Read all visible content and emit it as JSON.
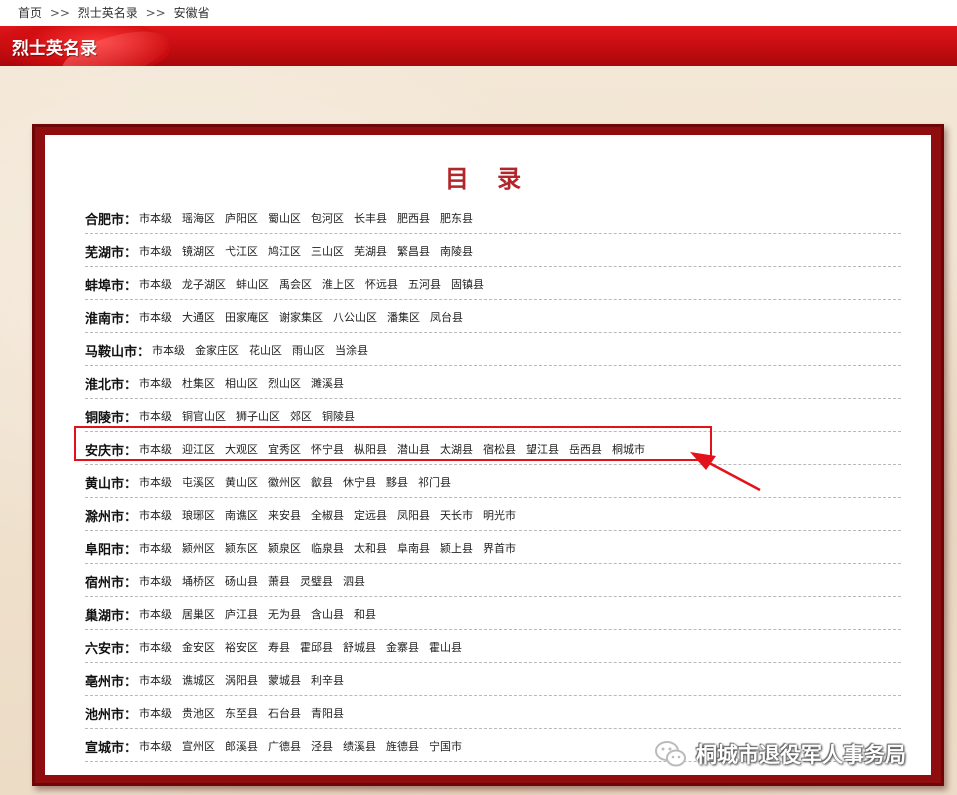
{
  "breadcrumb": [
    "首页",
    "烈士英名录",
    "安徽省"
  ],
  "breadcrumb_sep": ">>",
  "header": {
    "title": "烈士英名录"
  },
  "toc": {
    "title": "目 录",
    "rows": [
      {
        "city": "合肥市",
        "items": [
          "市本级",
          "瑶海区",
          "庐阳区",
          "蜀山区",
          "包河区",
          "长丰县",
          "肥西县",
          "肥东县"
        ]
      },
      {
        "city": "芜湖市",
        "items": [
          "市本级",
          "镜湖区",
          "弋江区",
          "鸠江区",
          "三山区",
          "芜湖县",
          "繁昌县",
          "南陵县"
        ]
      },
      {
        "city": "蚌埠市",
        "items": [
          "市本级",
          "龙子湖区",
          "蚌山区",
          "禹会区",
          "淮上区",
          "怀远县",
          "五河县",
          "固镇县"
        ]
      },
      {
        "city": "淮南市",
        "items": [
          "市本级",
          "大通区",
          "田家庵区",
          "谢家集区",
          "八公山区",
          "潘集区",
          "凤台县"
        ]
      },
      {
        "city": "马鞍山市",
        "items": [
          "市本级",
          "金家庄区",
          "花山区",
          "雨山区",
          "当涂县"
        ]
      },
      {
        "city": "淮北市",
        "items": [
          "市本级",
          "杜集区",
          "相山区",
          "烈山区",
          "濉溪县"
        ]
      },
      {
        "city": "铜陵市",
        "items": [
          "市本级",
          "铜官山区",
          "狮子山区",
          "郊区",
          "铜陵县"
        ]
      },
      {
        "city": "安庆市",
        "items": [
          "市本级",
          "迎江区",
          "大观区",
          "宜秀区",
          "怀宁县",
          "枞阳县",
          "潜山县",
          "太湖县",
          "宿松县",
          "望江县",
          "岳西县",
          "桐城市"
        ]
      },
      {
        "city": "黄山市",
        "items": [
          "市本级",
          "屯溪区",
          "黄山区",
          "徽州区",
          "歙县",
          "休宁县",
          "黟县",
          "祁门县"
        ]
      },
      {
        "city": "滁州市",
        "items": [
          "市本级",
          "琅琊区",
          "南谯区",
          "来安县",
          "全椒县",
          "定远县",
          "凤阳县",
          "天长市",
          "明光市"
        ]
      },
      {
        "city": "阜阳市",
        "items": [
          "市本级",
          "颍州区",
          "颍东区",
          "颍泉区",
          "临泉县",
          "太和县",
          "阜南县",
          "颍上县",
          "界首市"
        ]
      },
      {
        "city": "宿州市",
        "items": [
          "市本级",
          "埇桥区",
          "砀山县",
          "萧县",
          "灵璧县",
          "泗县"
        ]
      },
      {
        "city": "巢湖市",
        "items": [
          "市本级",
          "居巢区",
          "庐江县",
          "无为县",
          "含山县",
          "和县"
        ]
      },
      {
        "city": "六安市",
        "items": [
          "市本级",
          "金安区",
          "裕安区",
          "寿县",
          "霍邱县",
          "舒城县",
          "金寨县",
          "霍山县"
        ]
      },
      {
        "city": "亳州市",
        "items": [
          "市本级",
          "谯城区",
          "涡阳县",
          "蒙城县",
          "利辛县"
        ]
      },
      {
        "city": "池州市",
        "items": [
          "市本级",
          "贵池区",
          "东至县",
          "石台县",
          "青阳县"
        ]
      },
      {
        "city": "宣城市",
        "items": [
          "市本级",
          "宣州区",
          "郎溪县",
          "广德县",
          "泾县",
          "绩溪县",
          "旌德县",
          "宁国市"
        ]
      }
    ]
  },
  "watermark": {
    "text": "桐城市退役军人事务局",
    "icon": "wechat-icon"
  },
  "colors": {
    "accent": "#c10c10",
    "frame": "#8e0d0f",
    "highlight": "#e3111a",
    "title": "#b0262a"
  }
}
